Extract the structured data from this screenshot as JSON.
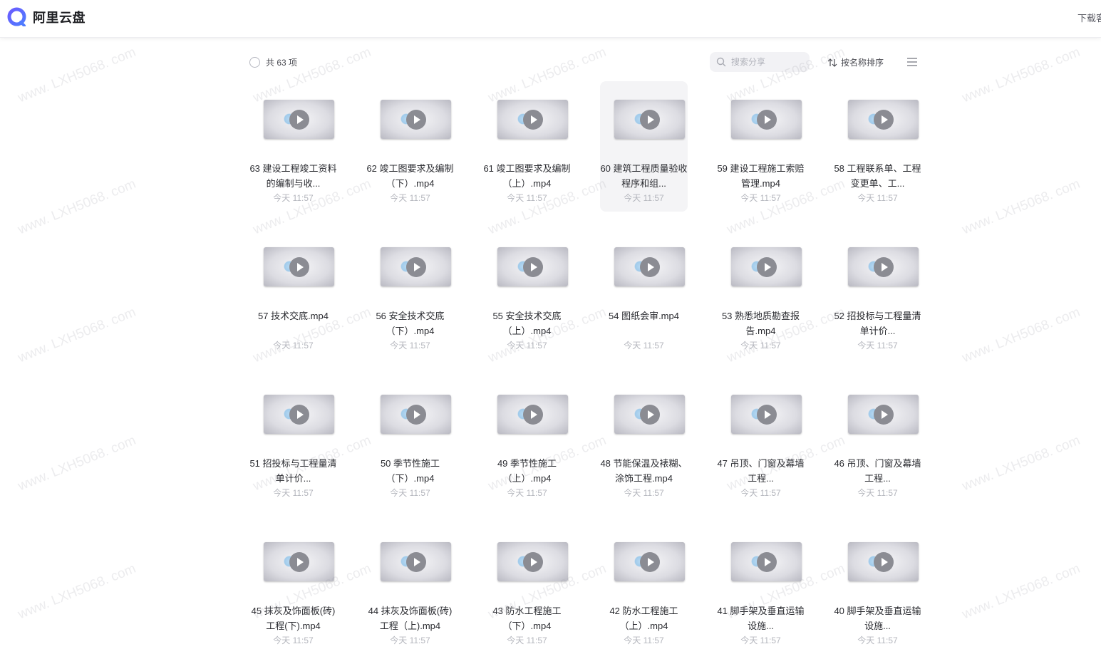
{
  "app": {
    "name": "阿里云盘"
  },
  "header": {
    "download_label": "下载客"
  },
  "toolbar": {
    "total_label": "共 63 项",
    "search_placeholder": "搜索分享",
    "sort_label": "按名称排序"
  },
  "watermark_text": "www. LXH5068. com",
  "files": [
    {
      "name": "63 建设工程竣工资料的编制与收...",
      "time": "今天 11:57"
    },
    {
      "name": "62 竣工图要求及编制（下）.mp4",
      "time": "今天 11:57"
    },
    {
      "name": "61 竣工图要求及编制（上）.mp4",
      "time": "今天 11:57"
    },
    {
      "name": "60 建筑工程质量验收程序和组...",
      "time": "今天 11:57"
    },
    {
      "name": "59 建设工程施工索赔管理.mp4",
      "time": "今天 11:57"
    },
    {
      "name": "58 工程联系单、工程变更单、工...",
      "time": "今天 11:57"
    },
    {
      "name": "57 技术交底.mp4",
      "time": "今天 11:57"
    },
    {
      "name": "56 安全技术交底（下）.mp4",
      "time": "今天 11:57"
    },
    {
      "name": "55 安全技术交底（上）.mp4",
      "time": "今天 11:57"
    },
    {
      "name": "54 图纸会审.mp4",
      "time": "今天 11:57"
    },
    {
      "name": "53 熟悉地质勘查报告.mp4",
      "time": "今天 11:57"
    },
    {
      "name": "52 招投标与工程量清单计价...",
      "time": "今天 11:57"
    },
    {
      "name": "51 招投标与工程量清单计价...",
      "time": "今天 11:57"
    },
    {
      "name": "50 季节性施工（下）.mp4",
      "time": "今天 11:57"
    },
    {
      "name": "49 季节性施工（上）.mp4",
      "time": "今天 11:57"
    },
    {
      "name": "48 节能保温及裱糊、涂饰工程.mp4",
      "time": "今天 11:57"
    },
    {
      "name": "47 吊顶、门窗及幕墙工程...",
      "time": "今天 11:57"
    },
    {
      "name": "46 吊顶、门窗及幕墙工程...",
      "time": "今天 11:57"
    },
    {
      "name": "45 抹灰及饰面板(砖)工程(下).mp4",
      "time": "今天 11:57"
    },
    {
      "name": "44 抹灰及饰面板(砖)工程（上).mp4",
      "time": "今天 11:57"
    },
    {
      "name": "43 防水工程施工（下）.mp4",
      "time": "今天 11:57"
    },
    {
      "name": "42 防水工程施工（上）.mp4",
      "time": "今天 11:57"
    },
    {
      "name": "41 脚手架及垂直运输设施...",
      "time": "今天 11:57"
    },
    {
      "name": "40 脚手架及垂直运输设施...",
      "time": "今天 11:57"
    }
  ]
}
